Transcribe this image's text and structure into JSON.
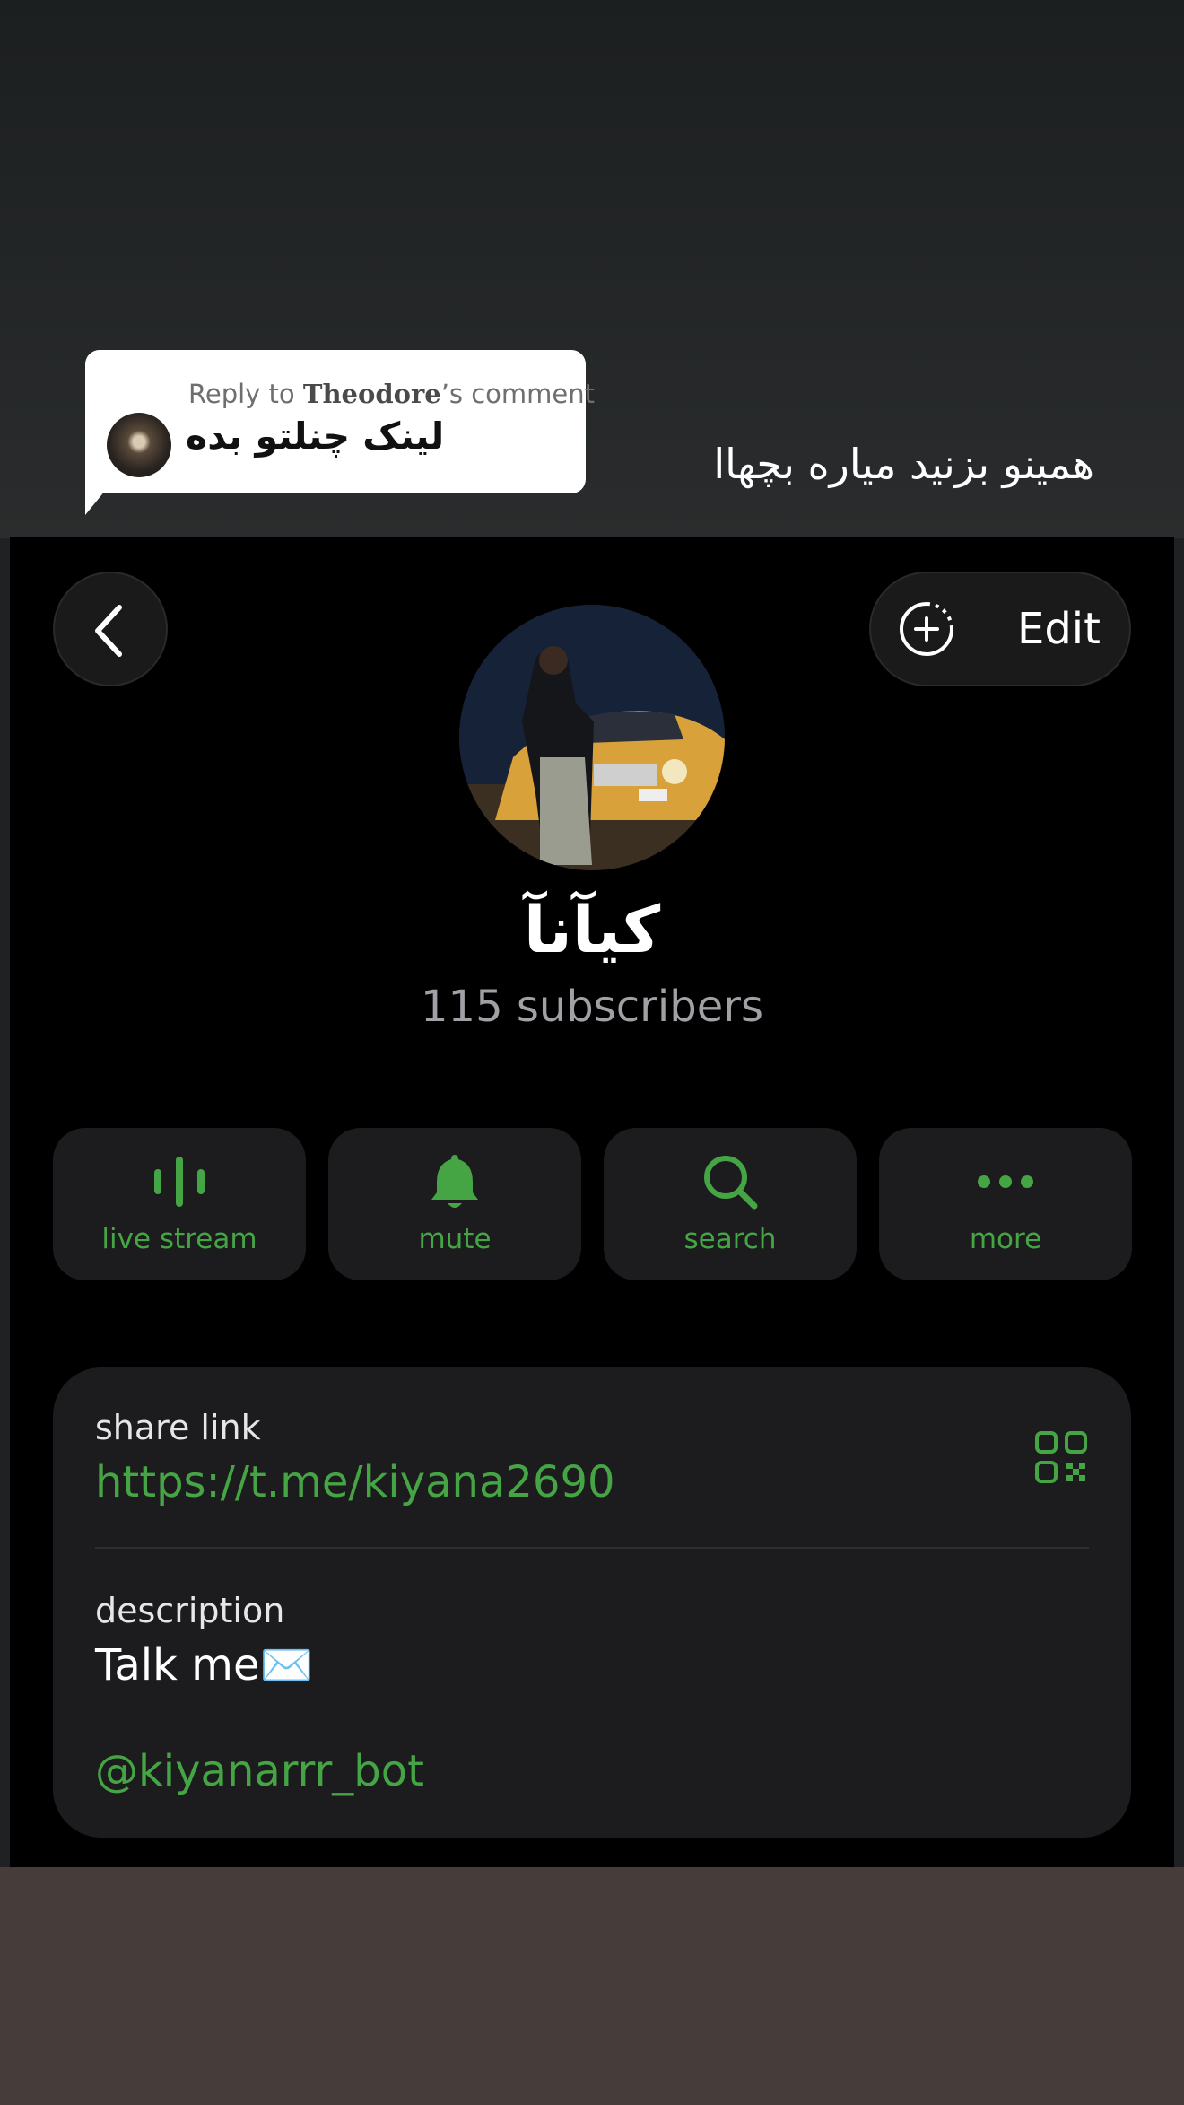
{
  "story_overlay": {
    "reply": {
      "prefix": "Reply to",
      "author": "Theodore",
      "suffix": "’s comment",
      "text": "لینک چنلتو بده"
    },
    "caption": "همینو بزنید میاره بچهاا"
  },
  "profile": {
    "edit_label": "Edit",
    "channel_name": "کیآنآ",
    "subscribers": "115 subscribers"
  },
  "actions": [
    {
      "label": "live stream",
      "icon": "live-stream-icon"
    },
    {
      "label": "mute",
      "icon": "bell-icon"
    },
    {
      "label": "search",
      "icon": "search-icon"
    },
    {
      "label": "more",
      "icon": "more-dots-icon"
    }
  ],
  "info": {
    "share_link_label": "share link",
    "share_link": "https://t.me/kiyana2690",
    "description_label": "description",
    "description": "Talk me✉️",
    "bot_username": "@kiyanarrr_bot"
  },
  "colors": {
    "accent": "#45a443",
    "panel_background": "#000000",
    "card_background": "#1c1c1e"
  }
}
